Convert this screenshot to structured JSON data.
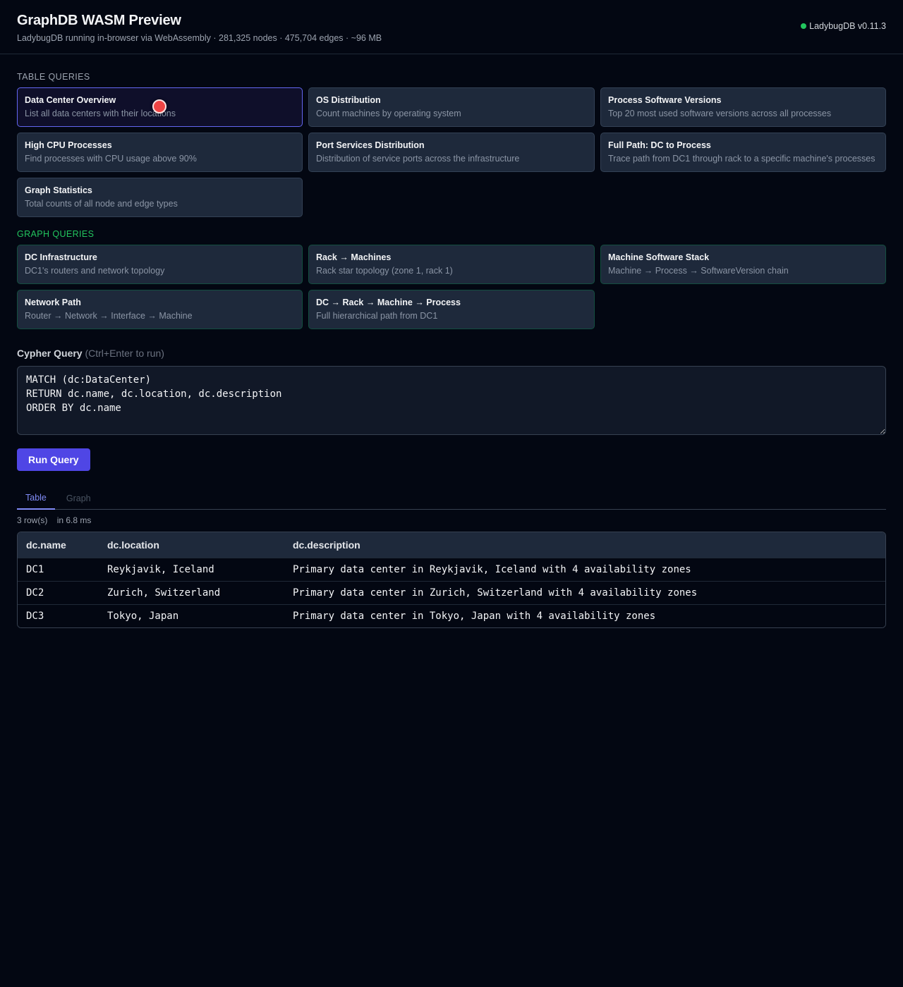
{
  "header": {
    "title": "GraphDB WASM Preview",
    "subtitle": "LadybugDB running in-browser via WebAssembly · 281,325 nodes · 475,704 edges · ~96 MB",
    "version": "LadybugDB v0.11.3",
    "status_color": "#22c55e"
  },
  "table_queries": {
    "heading": "TABLE QUERIES",
    "cards": [
      {
        "title": "Data Center Overview",
        "desc": "List all data centers with their locations"
      },
      {
        "title": "OS Distribution",
        "desc": "Count machines by operating system"
      },
      {
        "title": "Process Software Versions",
        "desc": "Top 20 most used software versions across all processes"
      },
      {
        "title": "High CPU Processes",
        "desc": "Find processes with CPU usage above 90%"
      },
      {
        "title": "Port Services Distribution",
        "desc": "Distribution of service ports across the infrastructure"
      },
      {
        "title": "Full Path: DC to Process",
        "desc": "Trace path from DC1 through rack to a specific machine's processes"
      },
      {
        "title": "Graph Statistics",
        "desc": "Total counts of all node and edge types"
      }
    ]
  },
  "graph_queries": {
    "heading": "GRAPH QUERIES",
    "cards": [
      {
        "title": "DC Infrastructure",
        "desc": "DC1's routers and network topology"
      },
      {
        "title": "Rack → Machines",
        "desc": "Rack star topology (zone 1, rack 1)"
      },
      {
        "title": "Machine Software Stack",
        "desc": "Machine → Process → SoftwareVersion chain"
      },
      {
        "title": "Network Path",
        "desc": "Router → Network → Interface → Machine"
      },
      {
        "title": "DC → Rack → Machine → Process",
        "desc": "Full hierarchical path from DC1"
      }
    ]
  },
  "editor": {
    "label": "Cypher Query",
    "hint": "(Ctrl+Enter to run)",
    "value": "MATCH (dc:DataCenter)\nRETURN dc.name, dc.location, dc.description\nORDER BY dc.name"
  },
  "run_button": "Run Query",
  "tabs": {
    "table": "Table",
    "graph": "Graph"
  },
  "meta": {
    "rows": "3 row(s)",
    "time": "in 6.8 ms"
  },
  "results": {
    "columns": [
      "dc.name",
      "dc.location",
      "dc.description"
    ],
    "rows": [
      [
        "DC1",
        "Reykjavik, Iceland",
        "Primary data center in Reykjavik, Iceland with 4 availability zones"
      ],
      [
        "DC2",
        "Zurich, Switzerland",
        "Primary data center in Zurich, Switzerland with 4 availability zones"
      ],
      [
        "DC3",
        "Tokyo, Japan",
        "Primary data center in Tokyo, Japan with 4 availability zones"
      ]
    ]
  },
  "colors": {
    "accent": "#4f46e5",
    "graph_accent": "#22c55e",
    "background": "#030712"
  }
}
